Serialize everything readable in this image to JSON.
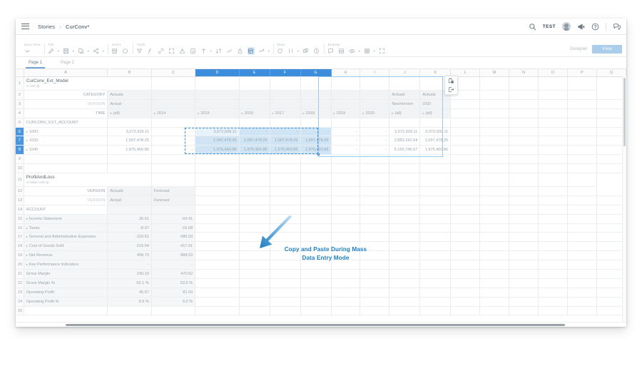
{
  "topbar": {
    "menu_icon": "hamburger-icon",
    "breadcrumb_root": "Stories",
    "breadcrumb_sep": "›",
    "breadcrumb_current": "CurConv*",
    "search_icon": "search-icon",
    "tenant_label": "TEST",
    "avatar": "user-avatar",
    "announce_icon": "megaphone-icon",
    "help_icon": "help-circle-icon",
    "chat_icon": "chat-bubble-icon"
  },
  "toolbar": {
    "groups": [
      {
        "label": "Data View",
        "items": [
          "chevron-down-icon"
        ]
      },
      {
        "label": "File",
        "items": [
          "edit-pencil-icon",
          "save-icon",
          "copy-icon",
          "share-icon"
        ]
      },
      {
        "label": "Insert",
        "items": [
          "table-insert-icon",
          "shape-insert-icon"
        ]
      },
      {
        "label": "Tools",
        "items": [
          "filter-icon",
          "formula-icon",
          "link-icon",
          "expand-icon",
          "alert-triangle-icon",
          "comment-edit-icon",
          "distribute-icon",
          "sort-icon",
          "publish-icon",
          "chart-icon",
          "lock-icon",
          "mass-data-entry-icon",
          "spread-icon"
        ]
      },
      {
        "label": "Data",
        "items": [
          "refresh-icon",
          "currency-icon",
          "copy-version-icon",
          "history-icon"
        ]
      },
      {
        "label": "Display",
        "items": [
          "comment-icon",
          "layout-icon",
          "visibility-icon",
          "grid-options-icon",
          "fullscreen-icon"
        ]
      }
    ],
    "designer_label": "Designer",
    "view_button": "View"
  },
  "page_tabs": [
    {
      "label": "Page 1",
      "active": true
    },
    {
      "label": "Page 2",
      "active": false
    }
  ],
  "grid": {
    "columns": [
      "A",
      "B",
      "C",
      "D",
      "E",
      "F",
      "G",
      "H",
      "I",
      "J",
      "K",
      "L",
      "M",
      "N",
      "O",
      "P",
      "Q"
    ],
    "selected_columns": [
      "D",
      "E",
      "F",
      "G"
    ],
    "selected_rows": [
      "6",
      "7",
      "8"
    ],
    "row_numbers": [
      "1",
      "2",
      "3",
      "4",
      "5",
      "6",
      "7",
      "8",
      "9",
      "10",
      "11",
      "12",
      "13",
      "14",
      "15",
      "16",
      "17",
      "18",
      "19",
      "20",
      "21",
      "22",
      "23",
      "24",
      "25"
    ],
    "model1": {
      "title": "CurConv_Ext_Model",
      "subtitle": "In USD",
      "dim_labels": {
        "category": "CATEGORY",
        "version": "VERSION",
        "time": "TIME"
      },
      "category_value": "Actuals",
      "version_value": "Actual",
      "time_value": "(all)",
      "years": [
        "2014",
        "2015",
        "2016",
        "2017",
        "2018",
        "2019",
        "2020"
      ],
      "extra_headers": [
        {
          "category": "Actuals",
          "version": "NewVersion",
          "time": "(all)"
        },
        {
          "category": "Actuals",
          "version": "USD",
          "time": "(all)"
        }
      ],
      "account_header": "CURCONV_EXT_ACCOUNT",
      "rows": [
        {
          "label": "1000",
          "indent": 0,
          "expanded": true,
          "b": "3,072,939.11",
          "c": "-",
          "sel": [
            "3,072,939.11",
            "-",
            "-",
            "-"
          ],
          "h": "-",
          "i": "-",
          "j": "3,072,939.11",
          "k": "3,072,939.11"
        },
        {
          "label": "1020",
          "indent": 1,
          "expanded": false,
          "b": "1,097,478.25",
          "c": "-",
          "sel": [
            "1,097,478.25",
            "1,097,478.25",
            "1,097,478.25",
            "1,097,478.25"
          ],
          "h": "-",
          "i": "-",
          "j": "2,883,192.54",
          "k": "1,097,478.25"
        },
        {
          "label": "1040",
          "indent": 1,
          "expanded": false,
          "b": "1,975,460.86",
          "c": "-",
          "sel": [
            "1,975,460.86",
            "1,975,460.86",
            "1,975,460.86",
            "1,975,460.86"
          ],
          "h": "-",
          "i": "-",
          "j": "5,169,746.57",
          "k": "1,975,460.86"
        }
      ]
    },
    "model2": {
      "title": "ProfitAndLoss",
      "subtitle": "In Million USD",
      "dim_labels": {
        "version1": "VERSION",
        "version2": "VERSION"
      },
      "version_row1": [
        "Actuals",
        "Forecast"
      ],
      "version_row2": [
        "Actual",
        "Forecast"
      ],
      "account_header": "ACCOUNT",
      "rows": [
        {
          "label": "Income Statement",
          "indent": 0,
          "expanded": true,
          "b": "36.61",
          "c": "-64.91"
        },
        {
          "label": "Taxes",
          "indent": 1,
          "expanded": false,
          "b": "-8.97",
          "c": "-16.68"
        },
        {
          "label": "General and Administrative Expenses",
          "indent": 1,
          "expanded": false,
          "b": "-193.62",
          "c": "-389.03"
        },
        {
          "label": "Cost of Goods Sold",
          "indent": 1,
          "expanded": false,
          "b": "-219.54",
          "c": "-417.91"
        },
        {
          "label": "Net Revenue",
          "indent": 1,
          "expanded": false,
          "b": "458.73",
          "c": "888.53"
        },
        {
          "label": "Key Performance Indicators",
          "indent": 0,
          "expanded": true,
          "b": "-",
          "c": "-"
        },
        {
          "label": "Gross Margin",
          "indent": 2,
          "expanded": false,
          "b": "239.19",
          "c": "470.62"
        },
        {
          "label": "Gross Margin %",
          "indent": 2,
          "expanded": false,
          "b": "52.1 %",
          "c": "53.0 %"
        },
        {
          "label": "Operating Profit",
          "indent": 2,
          "expanded": false,
          "b": "45.57",
          "c": "81.59"
        },
        {
          "label": "Operating Profit %",
          "indent": 2,
          "expanded": false,
          "b": "9.9 %",
          "c": "9.2 %"
        }
      ]
    },
    "mini_popup": {
      "icons": [
        "paste-options-icon",
        "exit-icon"
      ]
    }
  },
  "callout": {
    "line1": "Copy and Paste During Mass",
    "line2": "Data Entry Mode",
    "color": "#1f7fc4"
  },
  "colors": {
    "accent": "#3c8ddc",
    "selection_fill": "#cfe4f5",
    "active_cell": "#e8f2fb",
    "header_grey": "#f2f3f4",
    "callout_blue": "#1f7fc4"
  }
}
